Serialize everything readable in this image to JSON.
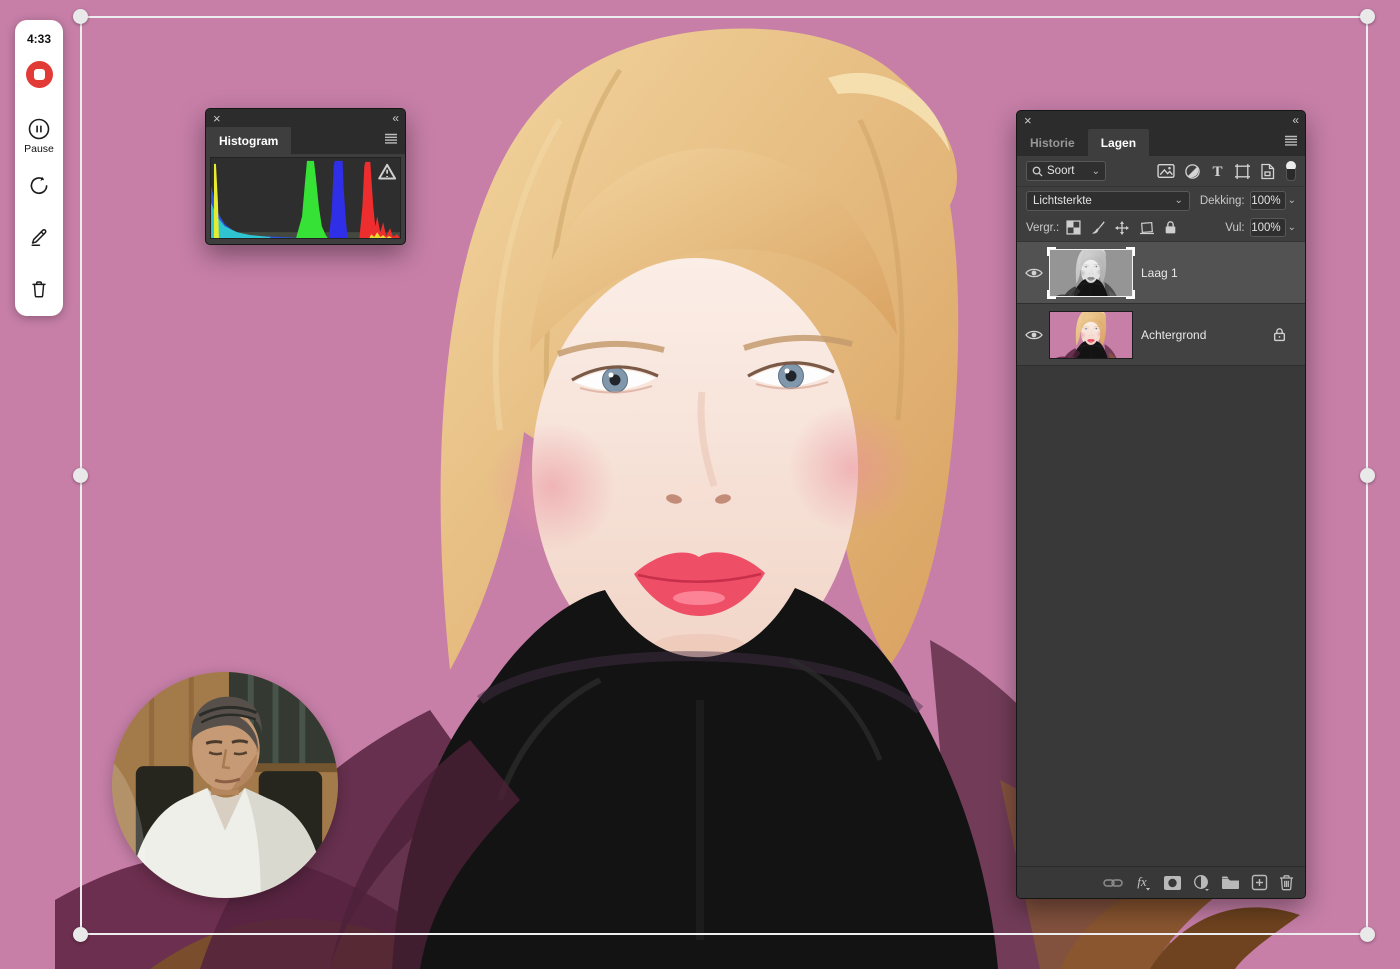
{
  "recorder": {
    "timer": "4:33",
    "pause_label": "Pause"
  },
  "glyphs": {
    "close": "×",
    "collapse": "«",
    "chevron_down": "⌄"
  },
  "histogram_panel": {
    "title": "Histogram",
    "has_clipping_warning": true,
    "channels_shown": [
      "red",
      "green",
      "blue"
    ],
    "distribution_note": "shadow spike far left, green peak ~53%, blue peak ~66%, red peak ~79%"
  },
  "layers_panel": {
    "tabs": [
      {
        "label": "Historie"
      },
      {
        "label": "Lagen"
      }
    ],
    "active_tab": "Lagen",
    "filter_label": "Soort",
    "type_filter_label": "T",
    "blend_mode": "Lichtsterkte",
    "opacity_label": "Dekking:",
    "opacity_value": "100%",
    "lock_label": "Vergr.:",
    "fill_label": "Vul:",
    "fill_value": "100%",
    "fx_label": "fx",
    "layers": [
      {
        "name": "Laag 1",
        "visible": true,
        "selected": true,
        "locked": false,
        "thumbnail": "black-and-white portrait"
      },
      {
        "name": "Achtergrond",
        "visible": true,
        "selected": false,
        "locked": true,
        "thumbnail": "color portrait on pink"
      }
    ]
  },
  "colors": {
    "pink_background": "#c77fa8",
    "record_red": "#e23b37",
    "panel_bg": "#3e3e3e",
    "panel_header": "#2c2c2c",
    "selected_layer_row": "#525252",
    "frame_white": "#eeeef0"
  }
}
